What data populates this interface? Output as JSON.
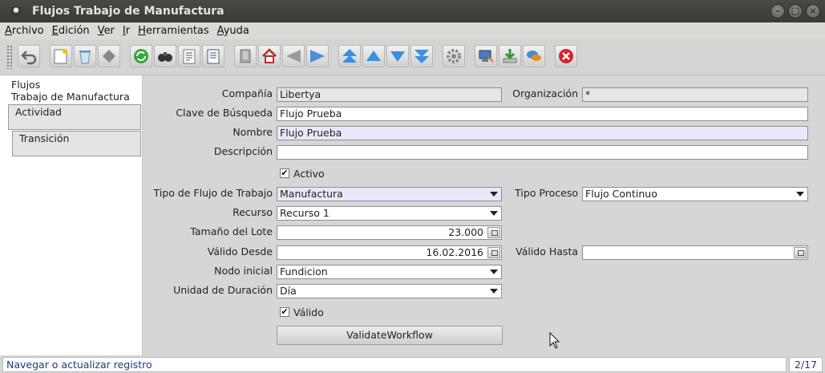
{
  "window": {
    "title": "Flujos Trabajo de Manufactura"
  },
  "menu": [
    "Archivo",
    "Edición",
    "Ver",
    "Ir",
    "Herramientas",
    "Ayuda"
  ],
  "toolbar": {
    "icons": [
      "undo-icon",
      "new-record-icon",
      "delete-icon",
      "delete-selection-icon",
      "refresh-icon",
      "find-icon",
      "history-icon",
      "report-icon",
      "archive-icon",
      "home-icon",
      "parent-icon",
      "detail-icon",
      "first-record-icon",
      "previous-record-icon",
      "next-record-icon",
      "last-record-icon",
      "process-icon",
      "export-icon",
      "import-icon",
      "chat-icon",
      "close-icon"
    ]
  },
  "tabs": [
    {
      "label_line1": "Flujos",
      "label_line2": "Trabajo de Manufactura",
      "active": true
    },
    {
      "label": "Actividad"
    },
    {
      "label": "Transición"
    }
  ],
  "form": {
    "compania": {
      "label": "Compañía",
      "value": "Libertya"
    },
    "organizacion": {
      "label": "Organización",
      "value": "*"
    },
    "clave": {
      "label": "Clave de Búsqueda",
      "value": "Flujo Prueba"
    },
    "nombre": {
      "label": "Nombre",
      "value": "Flujo Prueba"
    },
    "descripcion": {
      "label": "Descripción",
      "value": ""
    },
    "activo": {
      "label": "Activo",
      "checked": true
    },
    "tipo_flujo": {
      "label": "Tipo de Flujo de Trabajo",
      "value": "Manufactura"
    },
    "tipo_proceso": {
      "label": "Tipo Proceso",
      "value": "Flujo Continuo"
    },
    "recurso": {
      "label": "Recurso",
      "value": "Recurso 1"
    },
    "tamano_lote": {
      "label": "Tamaño del Lote",
      "value": "23.000"
    },
    "valido_desde": {
      "label": "Válido Desde",
      "value": "16.02.2016"
    },
    "valido_hasta": {
      "label": "Válido Hasta",
      "value": ""
    },
    "nodo_inicial": {
      "label": "Nodo inicial",
      "value": "Fundicion"
    },
    "unidad_duracion": {
      "label": "Unidad de Duración",
      "value": "Día"
    },
    "valido": {
      "label": "Válido",
      "checked": true
    },
    "validate_button": "ValidateWorkflow"
  },
  "checkmark": "✔",
  "status": {
    "message": "Navegar o actualizar registro",
    "record": "2/17"
  }
}
